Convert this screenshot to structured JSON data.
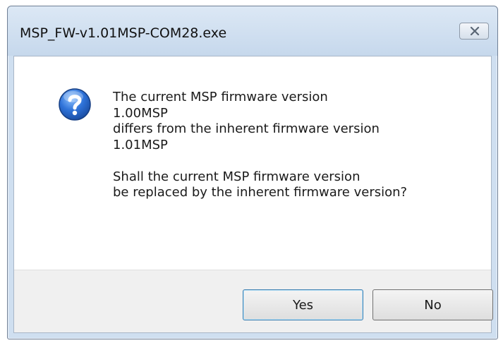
{
  "window": {
    "title": "MSP_FW-v1.01MSP-COM28.exe"
  },
  "icons": {
    "message": "question-icon",
    "close": "close-icon"
  },
  "message": {
    "lines": [
      "The current MSP firmware version",
      "1.00MSP",
      "differs from the inherent firmware version",
      "1.01MSP",
      "",
      "Shall the current MSP firmware version",
      "be replaced by the inherent firmware version?"
    ]
  },
  "buttons": {
    "yes_label": "Yes",
    "no_label": "No"
  }
}
